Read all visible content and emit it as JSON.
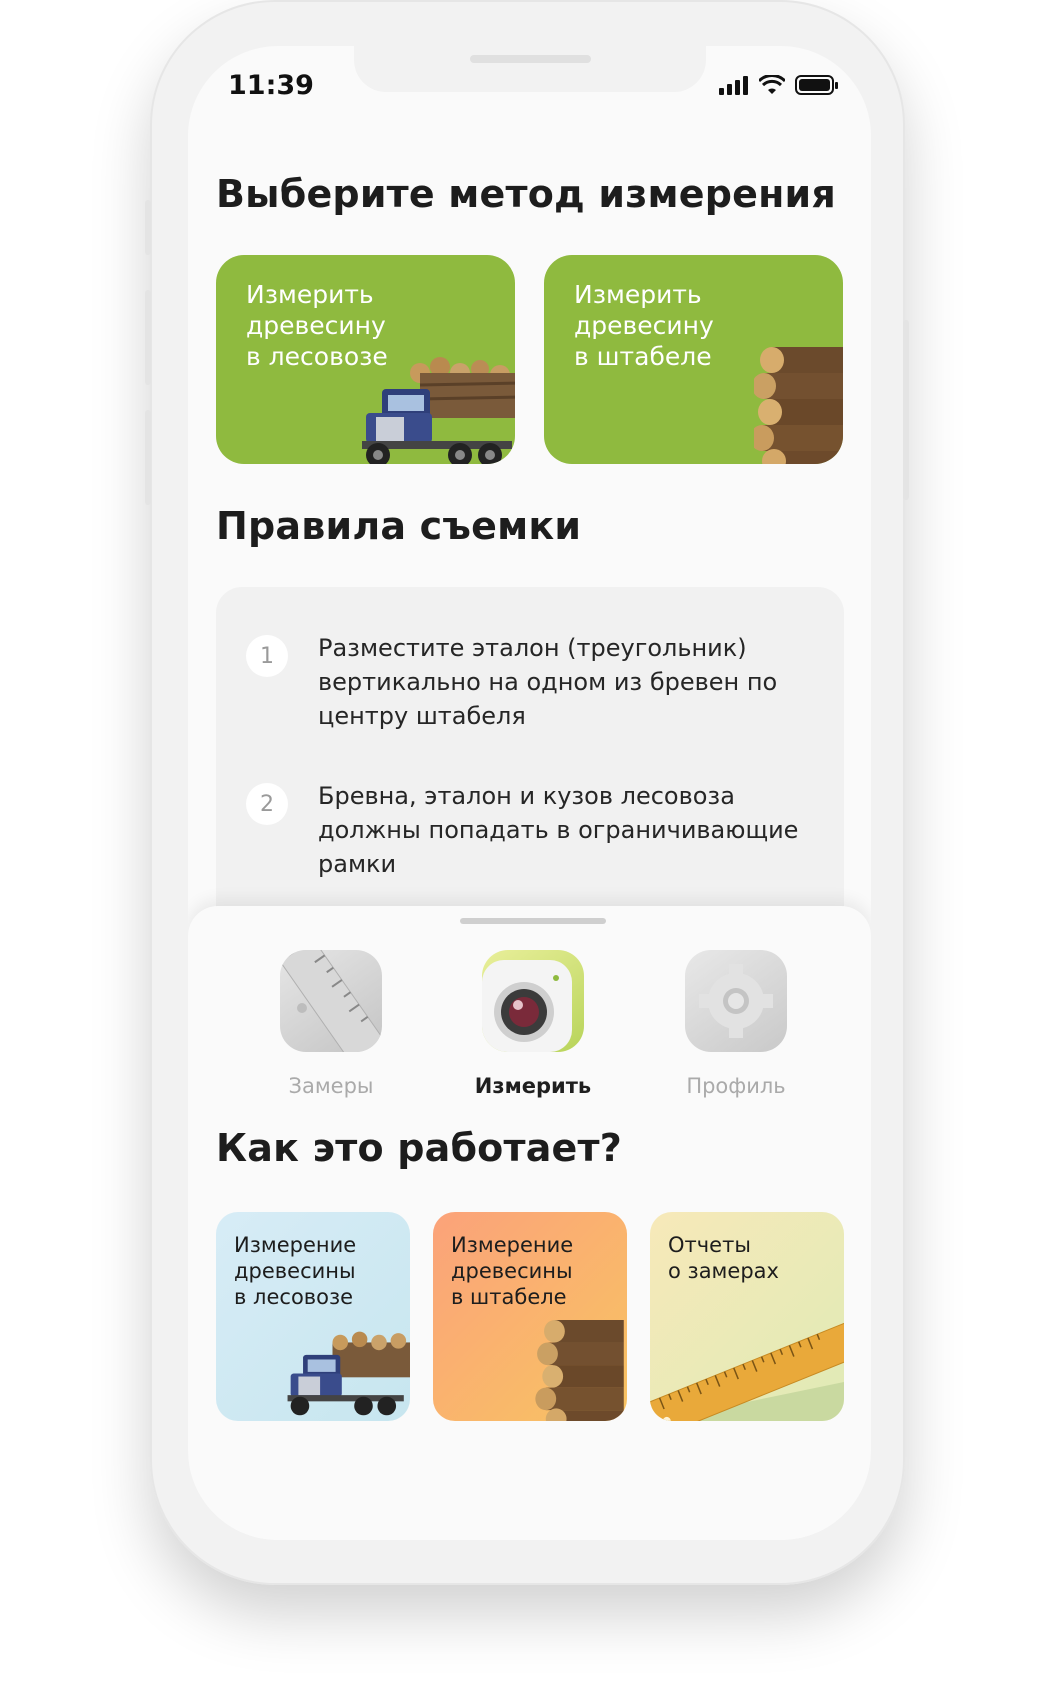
{
  "status_bar": {
    "time": "11:39"
  },
  "methods": {
    "title": "Выберите метод измерения",
    "items": [
      {
        "label": "Измерить\nдревесину\nв лесовозе",
        "icon": "logging-truck"
      },
      {
        "label": "Измерить\nдревесину\nв штабеле",
        "icon": "log-stack"
      }
    ],
    "accent": "#8fba3f"
  },
  "rules": {
    "title": "Правила съемки",
    "items": [
      {
        "num": "1",
        "text": "Разместите эталон (треугольник) вертикально на одном из бревен по центру штабеля"
      },
      {
        "num": "2",
        "text": "Бревна, эталон и кузов лесовоза должны попадать в ограничивающие рамки"
      }
    ]
  },
  "tabbar": {
    "items": [
      {
        "label": "Замеры",
        "icon": "ruler-icon",
        "active": false
      },
      {
        "label": "Измерить",
        "icon": "camera-icon",
        "active": true
      },
      {
        "label": "Профиль",
        "icon": "gear-icon",
        "active": false
      }
    ]
  },
  "how": {
    "title": "Как это работает?",
    "items": [
      {
        "label": "Измерение\nдревесины\nв лесовозе",
        "icon": "logging-truck"
      },
      {
        "label": "Измерение\nдревесины\nв штабеле",
        "icon": "log-stack"
      },
      {
        "label": "Отчеты\nо замерах",
        "icon": "ruler"
      }
    ]
  }
}
